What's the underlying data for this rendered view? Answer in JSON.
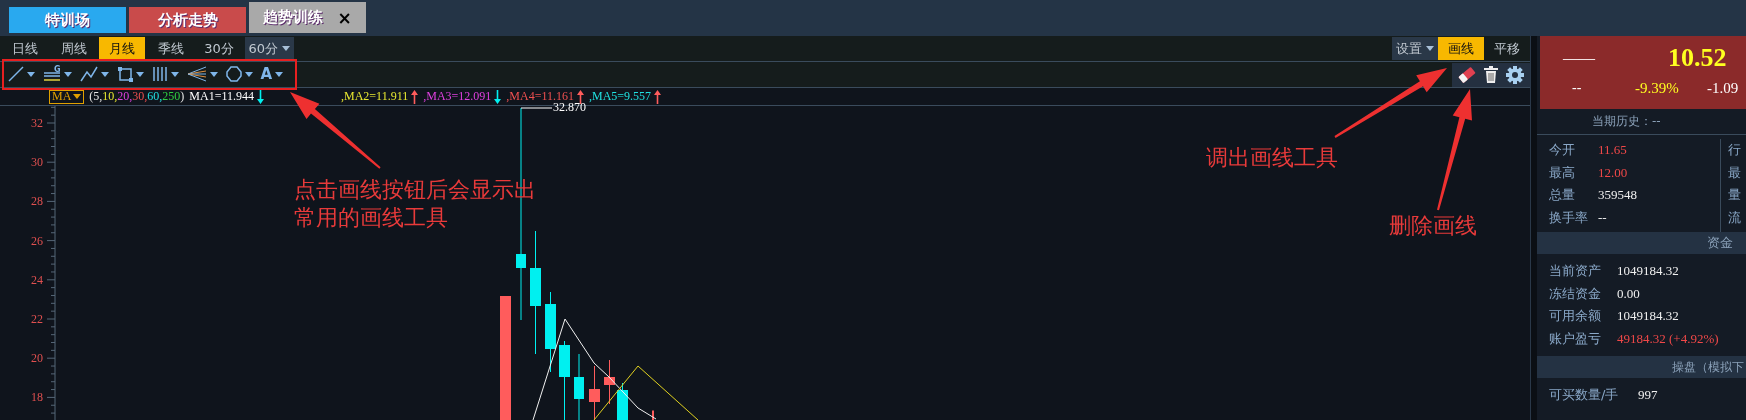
{
  "tabs": [
    {
      "label": "特训场",
      "color": "#29a9ef",
      "selected": false
    },
    {
      "label": "分析走势",
      "color": "#c94b4b",
      "selected": false
    },
    {
      "label": "趋势训练",
      "color": "#a9a9a9",
      "selected": true,
      "close": "×"
    }
  ],
  "periods": [
    {
      "label": "日线",
      "selected": false
    },
    {
      "label": "周线",
      "selected": false
    },
    {
      "label": "月线",
      "selected": true
    },
    {
      "label": "季线",
      "selected": false
    },
    {
      "label": "30分",
      "selected": false
    },
    {
      "label": "60分",
      "selected": false,
      "dropdown": true
    }
  ],
  "modes": [
    {
      "label": "设置",
      "selected": false,
      "dropdown": true
    },
    {
      "label": "画线",
      "selected": true
    },
    {
      "label": "平移",
      "selected": false
    }
  ],
  "draw_tools": [
    {
      "kind": "line"
    },
    {
      "kind": "fib",
      "glyph": "G"
    },
    {
      "kind": "polyline"
    },
    {
      "kind": "rect"
    },
    {
      "kind": "vlines"
    },
    {
      "kind": "fan"
    },
    {
      "kind": "polygon"
    },
    {
      "kind": "text",
      "glyph": "A"
    }
  ],
  "draw_actions": [
    {
      "kind": "eraser"
    },
    {
      "kind": "trash"
    },
    {
      "kind": "settings"
    }
  ],
  "ma": {
    "button": "MA",
    "params": [
      "(5,",
      "10,",
      "20,",
      "30,",
      "60,",
      "250",
      ")"
    ],
    "lines": [
      {
        "text": "MA1=11.944",
        "rising": false
      },
      {
        "text": ",MA2=11.911",
        "rising": true
      },
      {
        "text": ",MA3=12.091",
        "rising": false
      },
      {
        "text": ",MA4=11.161",
        "rising": true
      },
      {
        "text": ",MA5=9.557",
        "rising": true
      }
    ]
  },
  "chart": {
    "y_labels": [
      "32",
      "30",
      "28",
      "26",
      "24",
      "22",
      "20",
      "18"
    ],
    "high_label": "32.870"
  },
  "annotations": [
    {
      "lines": [
        "点击画线按钮后会显示出",
        "常用的画线工具"
      ]
    },
    {
      "lines": [
        "调出画线工具"
      ]
    },
    {
      "lines": [
        "删除画线"
      ]
    }
  ],
  "quote": {
    "name": "——",
    "price": "10.52",
    "code": "--",
    "change_pct": "-9.39%",
    "change": "-1.09"
  },
  "history": "当期历史：--",
  "stats": [
    {
      "label": "今开",
      "value": "11.65",
      "positive": true
    },
    {
      "label": "最高",
      "value": "12.00",
      "positive": true
    },
    {
      "label": "总量",
      "value": "359548",
      "positive": false
    },
    {
      "label": "换手率",
      "value": "--",
      "positive": false
    }
  ],
  "stats_right": [
    "行",
    "最",
    "量",
    "流"
  ],
  "funds": {
    "title": "资金",
    "rows": [
      {
        "label": "当前资产",
        "value": "1049184.32",
        "positive": false
      },
      {
        "label": "冻结资金",
        "value": "0.00",
        "positive": false
      },
      {
        "label": "可用余额",
        "value": "1049184.32",
        "positive": false
      },
      {
        "label": "账户盈亏",
        "value": "49184.32  (+4.92%)",
        "positive": true
      }
    ]
  },
  "trade": {
    "title": "操盘（模拟下",
    "rows": [
      {
        "label": "可买数量/手",
        "value": "997",
        "positive": false
      }
    ]
  }
}
